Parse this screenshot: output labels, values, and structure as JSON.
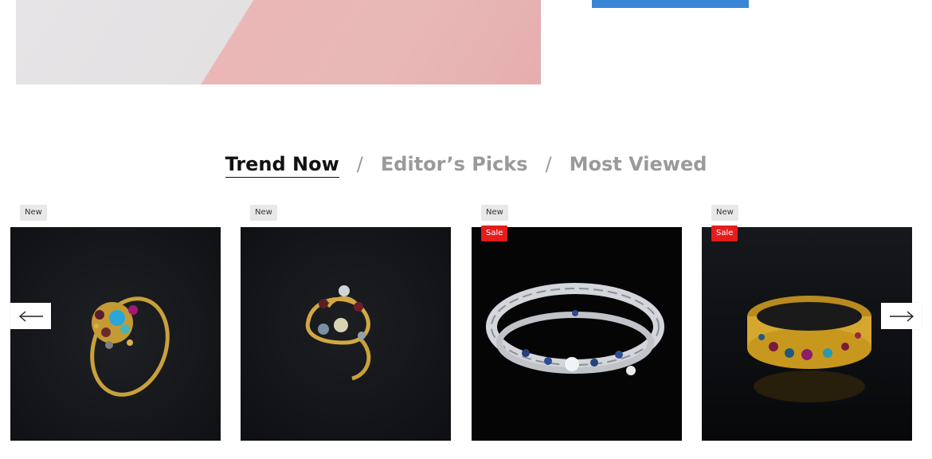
{
  "hero": {
    "button_label": ""
  },
  "product_tabs": {
    "items": [
      {
        "label": "Trend Now",
        "active": true
      },
      {
        "label": "Editor’s Picks",
        "active": false
      },
      {
        "label": "Most Viewed",
        "active": false
      }
    ],
    "separator": "/"
  },
  "products": [
    {
      "image": "gold ring with blue topaz and gemstones",
      "badges": [
        "New"
      ]
    },
    {
      "image": "gold swirl ring with small stones",
      "badges": [
        "New"
      ]
    },
    {
      "image": "silver filigree bracelet with sapphires",
      "badges": [
        "New",
        "Sale"
      ]
    },
    {
      "image": "gold bangle with colored gemstones",
      "badges": [
        "New",
        "Sale"
      ]
    }
  ],
  "badges": {
    "new_label": "New",
    "sale_label": "Sale"
  },
  "carousel": {
    "prev_icon": "arrow-left-icon",
    "next_icon": "arrow-right-icon"
  },
  "colors": {
    "active_tab": "#111111",
    "inactive_tab": "#9a9a9a",
    "sale_badge": "#e41c1c",
    "new_badge": "#e8e8e8",
    "cta_button": "#3a86d6"
  }
}
